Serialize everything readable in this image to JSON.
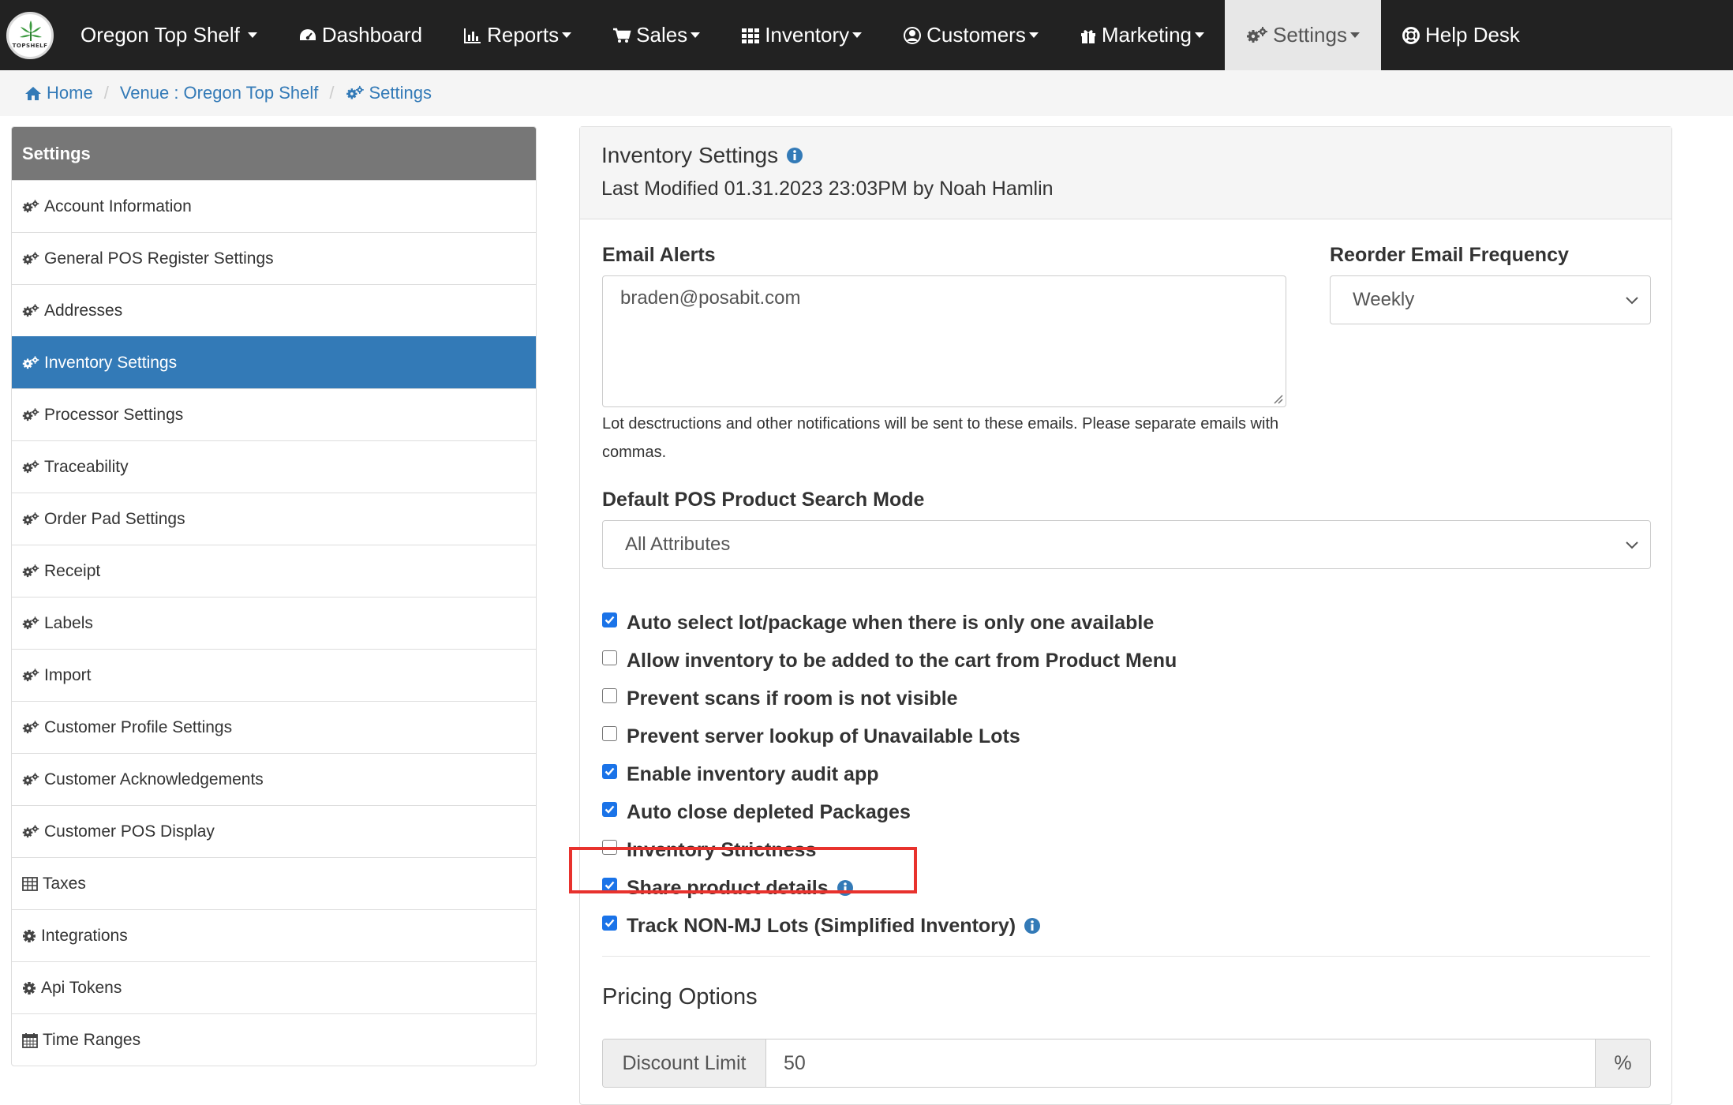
{
  "nav": {
    "brand": "Oregon Top Shelf",
    "logo_text": "TOPSHELF",
    "items": [
      {
        "label": "Dashboard",
        "icon": "dashboard-icon"
      },
      {
        "label": "Reports",
        "icon": "bar-chart-icon"
      },
      {
        "label": "Sales",
        "icon": "cart-icon"
      },
      {
        "label": "Inventory",
        "icon": "grid-icon"
      },
      {
        "label": "Customers",
        "icon": "user-circle-icon"
      },
      {
        "label": "Marketing",
        "icon": "gift-icon"
      },
      {
        "label": "Settings",
        "icon": "gears-icon"
      },
      {
        "label": "Help Desk",
        "icon": "life-ring-icon"
      }
    ]
  },
  "breadcrumb": {
    "home": "Home",
    "venue": "Venue : Oregon Top Shelf",
    "settings": "Settings"
  },
  "sidebar": {
    "heading": "Settings",
    "items": [
      {
        "label": "Account Information"
      },
      {
        "label": "General POS Register Settings"
      },
      {
        "label": "Addresses"
      },
      {
        "label": "Inventory Settings"
      },
      {
        "label": "Processor Settings"
      },
      {
        "label": "Traceability"
      },
      {
        "label": "Order Pad Settings"
      },
      {
        "label": "Receipt"
      },
      {
        "label": "Labels"
      },
      {
        "label": "Import"
      },
      {
        "label": "Customer Profile Settings"
      },
      {
        "label": "Customer Acknowledgements"
      },
      {
        "label": "Customer POS Display"
      },
      {
        "label": "Taxes"
      },
      {
        "label": "Integrations"
      },
      {
        "label": "Api Tokens"
      },
      {
        "label": "Time Ranges"
      }
    ]
  },
  "panel": {
    "title": "Inventory Settings",
    "last_modified": "Last Modified 01.31.2023 23:03PM by Noah Hamlin",
    "email_alerts_label": "Email Alerts",
    "email_alerts_value": "braden@posabit.com",
    "email_help": "Lot desctructions and other notifications will be sent to these emails. Please separate emails with commas.",
    "reorder_label": "Reorder Email Frequency",
    "reorder_value": "Weekly",
    "search_mode_label": "Default POS Product Search Mode",
    "search_mode_value": "All Attributes",
    "checkboxes": [
      {
        "label": "Auto select lot/package when there is only one available",
        "checked": true
      },
      {
        "label": "Allow inventory to be added to the cart from Product Menu",
        "checked": false
      },
      {
        "label": "Prevent scans if room is not visible",
        "checked": false
      },
      {
        "label": "Prevent server lookup of Unavailable Lots",
        "checked": false
      },
      {
        "label": "Enable inventory audit app",
        "checked": true
      },
      {
        "label": "Auto close depleted Packages",
        "checked": true
      },
      {
        "label": "Inventory Strictness",
        "checked": false
      },
      {
        "label": "Share product details",
        "checked": true
      },
      {
        "label": "Track NON-MJ Lots (Simplified Inventory)",
        "checked": true
      }
    ],
    "pricing_title": "Pricing Options",
    "discount_label": "Discount Limit",
    "discount_value": "50",
    "discount_unit": "%"
  },
  "colors": {
    "navbar": "#222222",
    "active_blue": "#337ab7",
    "checkbox_blue": "#1a73e8",
    "highlight_red": "#e8322d",
    "sidebar_head": "#777777"
  }
}
